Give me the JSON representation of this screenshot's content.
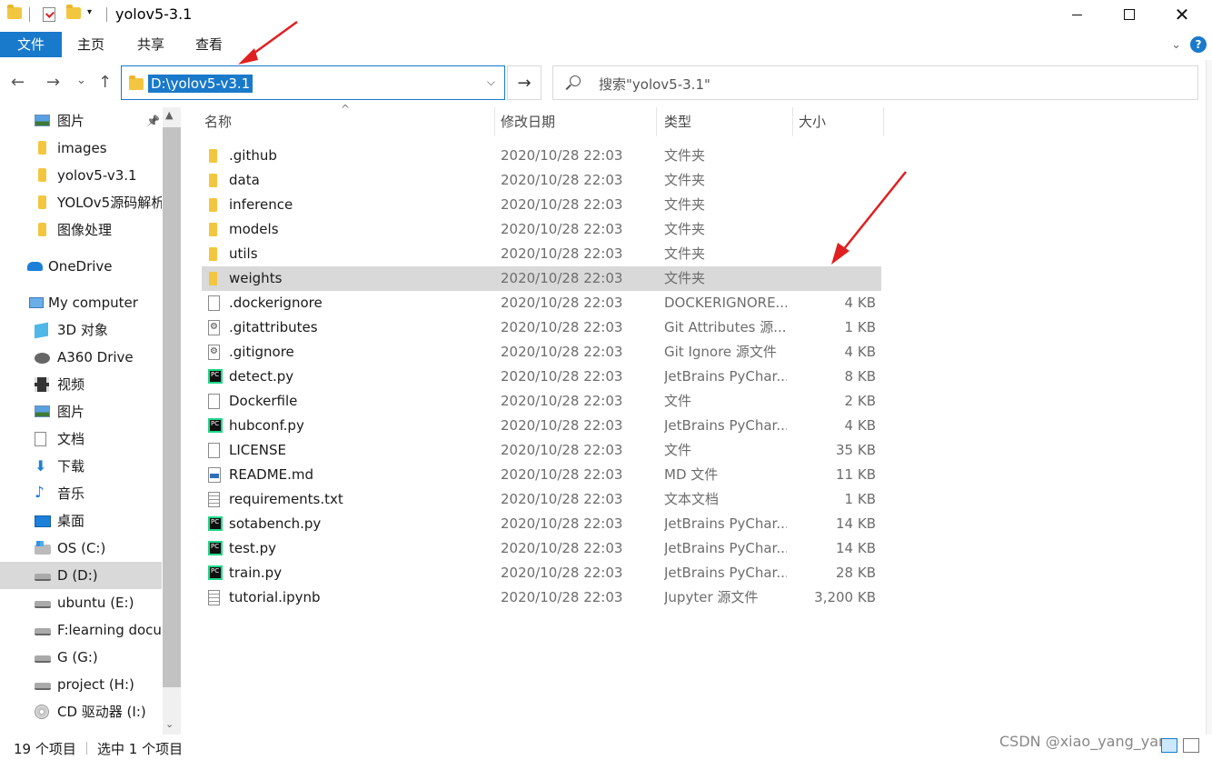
{
  "window": {
    "title": "yolov5-3.1",
    "minimize": "—",
    "close": "✕"
  },
  "ribbon": {
    "tabs": [
      "文件",
      "主页",
      "共享",
      "查看"
    ],
    "help": "?"
  },
  "nav": {
    "back": "←",
    "forward": "→",
    "recent": "⌄",
    "up": "↑",
    "address": "D:\\yolov5-v3.1",
    "refresh": "→",
    "search_placeholder": "搜索\"yolov5-3.1\""
  },
  "sidebar": {
    "items": [
      {
        "label": "图片",
        "icon": "picture-icon",
        "pinned": true
      },
      {
        "label": "images",
        "icon": "folder-icon"
      },
      {
        "label": "yolov5-v3.1",
        "icon": "folder-icon"
      },
      {
        "label": "YOLOv5源码解析",
        "icon": "folder-icon"
      },
      {
        "label": "图像处理",
        "icon": "folder-icon"
      },
      {
        "label": "OneDrive",
        "icon": "cloud-icon"
      },
      {
        "label": "My computer",
        "icon": "computer-icon"
      },
      {
        "label": "3D 对象",
        "icon": "cube-icon"
      },
      {
        "label": "A360 Drive",
        "icon": "a360-drive-icon"
      },
      {
        "label": "视频",
        "icon": "video-icon"
      },
      {
        "label": "图片",
        "icon": "picture-icon"
      },
      {
        "label": "文档",
        "icon": "document-icon"
      },
      {
        "label": "下载",
        "icon": "download-icon"
      },
      {
        "label": "音乐",
        "icon": "music-icon"
      },
      {
        "label": "桌面",
        "icon": "desktop-icon"
      },
      {
        "label": "OS (C:)",
        "icon": "os-drive-icon"
      },
      {
        "label": "D (D:)",
        "icon": "hard-drive-icon",
        "selected": true
      },
      {
        "label": "ubuntu (E:)",
        "icon": "hard-drive-icon"
      },
      {
        "label": "F:learning docu",
        "icon": "hard-drive-icon"
      },
      {
        "label": "G (G:)",
        "icon": "hard-drive-icon"
      },
      {
        "label": "project (H:)",
        "icon": "hard-drive-icon"
      },
      {
        "label": "CD 驱动器 (I:)",
        "icon": "cd-drive-icon"
      }
    ]
  },
  "columns": {
    "name": "名称",
    "date": "修改日期",
    "type": "类型",
    "size": "大小"
  },
  "files": [
    {
      "name": ".github",
      "date": "2020/10/28 22:03",
      "type": "文件夹",
      "size": "",
      "icon": "folder"
    },
    {
      "name": "data",
      "date": "2020/10/28 22:03",
      "type": "文件夹",
      "size": "",
      "icon": "folder"
    },
    {
      "name": "inference",
      "date": "2020/10/28 22:03",
      "type": "文件夹",
      "size": "",
      "icon": "folder"
    },
    {
      "name": "models",
      "date": "2020/10/28 22:03",
      "type": "文件夹",
      "size": "",
      "icon": "folder"
    },
    {
      "name": "utils",
      "date": "2020/10/28 22:03",
      "type": "文件夹",
      "size": "",
      "icon": "folder"
    },
    {
      "name": "weights",
      "date": "2020/10/28 22:03",
      "type": "文件夹",
      "size": "",
      "icon": "folder",
      "selected": true
    },
    {
      "name": ".dockerignore",
      "date": "2020/10/28 22:03",
      "type": "DOCKERIGNORE...",
      "size": "4 KB",
      "icon": "blank"
    },
    {
      "name": ".gitattributes",
      "date": "2020/10/28 22:03",
      "type": "Git Attributes 源...",
      "size": "1 KB",
      "icon": "gear"
    },
    {
      "name": ".gitignore",
      "date": "2020/10/28 22:03",
      "type": "Git Ignore 源文件",
      "size": "4 KB",
      "icon": "gear"
    },
    {
      "name": "detect.py",
      "date": "2020/10/28 22:03",
      "type": "JetBrains PyChar...",
      "size": "8 KB",
      "icon": "pc"
    },
    {
      "name": "Dockerfile",
      "date": "2020/10/28 22:03",
      "type": "文件",
      "size": "2 KB",
      "icon": "blank"
    },
    {
      "name": "hubconf.py",
      "date": "2020/10/28 22:03",
      "type": "JetBrains PyChar...",
      "size": "4 KB",
      "icon": "pc"
    },
    {
      "name": "LICENSE",
      "date": "2020/10/28 22:03",
      "type": "文件",
      "size": "35 KB",
      "icon": "blank"
    },
    {
      "name": "README.md",
      "date": "2020/10/28 22:03",
      "type": "MD 文件",
      "size": "11 KB",
      "icon": "md"
    },
    {
      "name": "requirements.txt",
      "date": "2020/10/28 22:03",
      "type": "文本文档",
      "size": "1 KB",
      "icon": "txt"
    },
    {
      "name": "sotabench.py",
      "date": "2020/10/28 22:03",
      "type": "JetBrains PyChar...",
      "size": "14 KB",
      "icon": "pc"
    },
    {
      "name": "test.py",
      "date": "2020/10/28 22:03",
      "type": "JetBrains PyChar...",
      "size": "14 KB",
      "icon": "pc"
    },
    {
      "name": "train.py",
      "date": "2020/10/28 22:03",
      "type": "JetBrains PyChar...",
      "size": "28 KB",
      "icon": "pc"
    },
    {
      "name": "tutorial.ipynb",
      "date": "2020/10/28 22:03",
      "type": "Jupyter 源文件",
      "size": "3,200 KB",
      "icon": "txt"
    }
  ],
  "status": {
    "count": "19 个项目",
    "selected": "选中 1 个项目"
  },
  "watermark": "CSDN @xiao_yang_yang",
  "colors": {
    "accent": "#1979ca",
    "selection": "#d9d9d9",
    "annotation": "#e02020"
  }
}
